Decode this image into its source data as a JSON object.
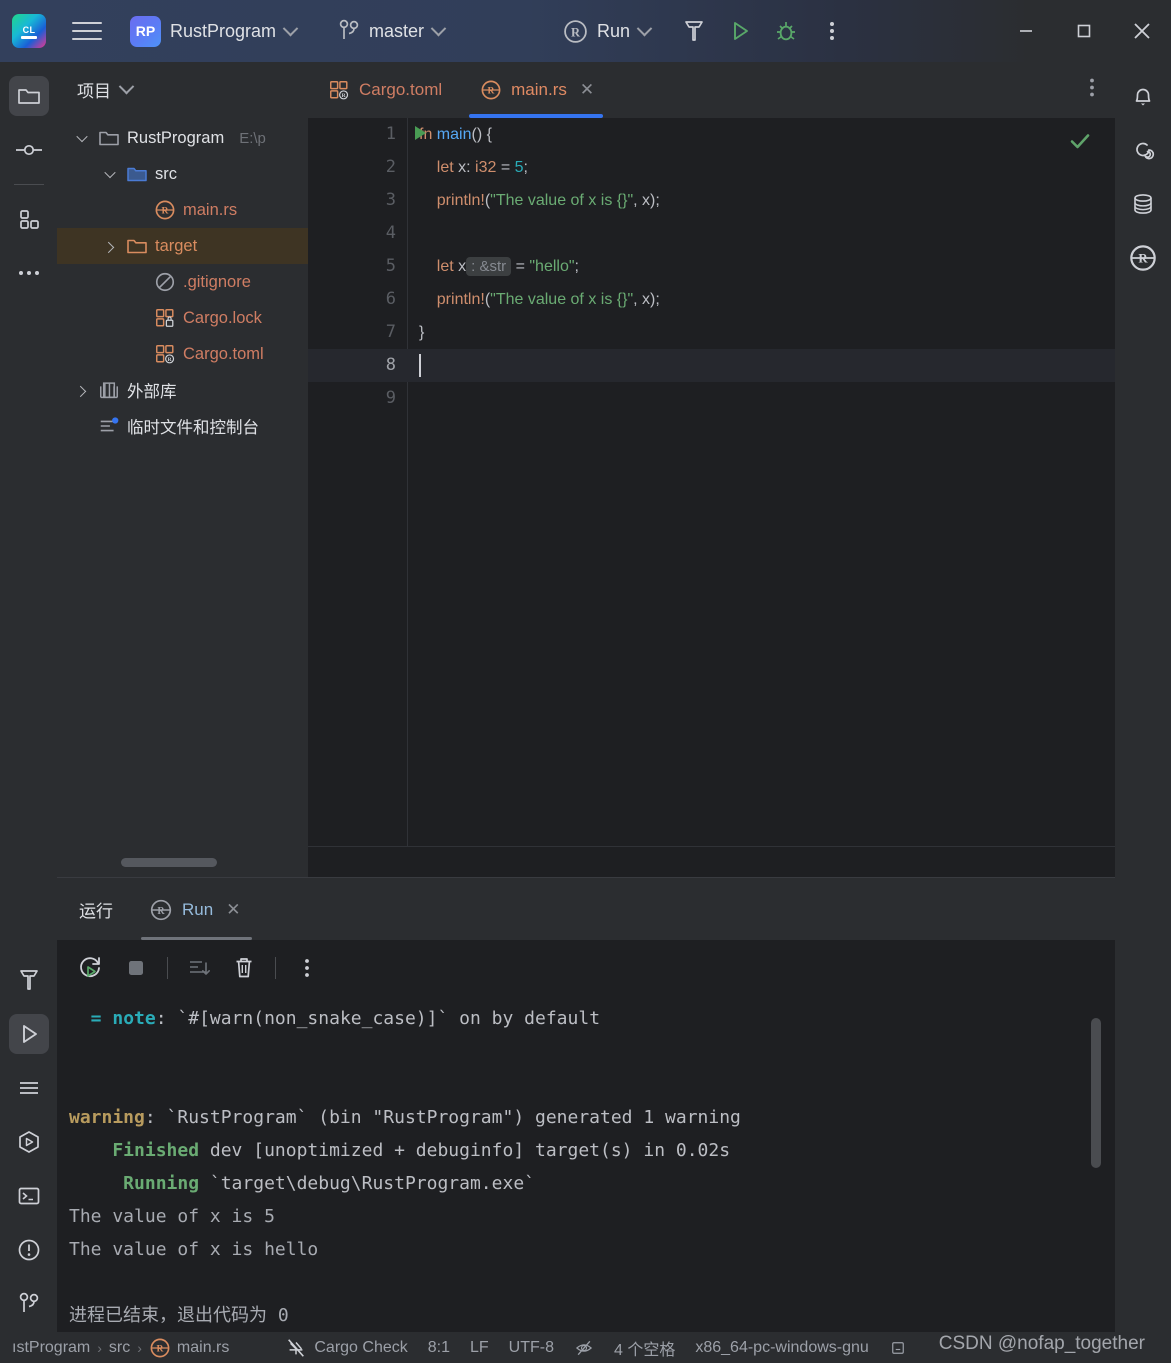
{
  "titlebar": {
    "ide_icon": "clion-logo-icon",
    "menu_icon": "hamburger-menu-icon",
    "project_badge": "RP",
    "project_name": "RustProgram",
    "branch_icon": "git-branch-icon",
    "branch_name": "master",
    "run_config_icon": "rust-logo-icon",
    "run_config_name": "Run",
    "build_icon": "hammer-build-icon",
    "run_icon": "run-triangle-icon",
    "debug_icon": "debug-bug-icon",
    "more_icon": "more-vertical-icon",
    "minimize": "–",
    "maximize": "□",
    "close": "✕"
  },
  "left_rail": {
    "items": [
      {
        "name": "project-tool-window",
        "icon": "folder-icon",
        "active": true
      },
      {
        "name": "commit-tool-window",
        "icon": "commit-node-icon",
        "active": false
      },
      {
        "name": "structure-tool-window",
        "icon": "structure-blocks-icon",
        "active": false
      },
      {
        "name": "more-tool-windows",
        "icon": "ellipsis-icon",
        "active": false
      }
    ],
    "bottom_items": [
      {
        "name": "build-tool-window",
        "icon": "hammer-icon",
        "active": false
      },
      {
        "name": "run-tool-window",
        "icon": "run-triangle-icon",
        "active": true
      },
      {
        "name": "todo-tool-window",
        "icon": "lines-icon",
        "active": false
      },
      {
        "name": "debug-tool-window",
        "icon": "hex-run-icon",
        "active": false
      },
      {
        "name": "terminal-tool-window",
        "icon": "terminal-icon",
        "active": false
      },
      {
        "name": "problems-tool-window",
        "icon": "exclamation-circle-icon",
        "active": false
      },
      {
        "name": "version-control-tool-window",
        "icon": "git-branch-icon",
        "active": false
      }
    ]
  },
  "right_rail": {
    "items": [
      {
        "name": "notifications",
        "icon": "bell-icon"
      },
      {
        "name": "ai-assistant",
        "icon": "spiral-icon"
      },
      {
        "name": "database",
        "icon": "database-icon"
      },
      {
        "name": "rust-tool-window",
        "icon": "rust-logo-icon"
      }
    ]
  },
  "project_panel": {
    "title": "项目",
    "title_chevron": "chevron-down-icon",
    "tree": [
      {
        "indent": 0,
        "arrow": "down",
        "icon": "folder-icon",
        "label": "RustProgram",
        "path": "E:\\p",
        "kind": "root",
        "selected": false
      },
      {
        "indent": 1,
        "arrow": "down",
        "icon": "folder-blue-icon",
        "label": "src",
        "path": "",
        "kind": "src",
        "selected": false
      },
      {
        "indent": 2,
        "arrow": "none",
        "icon": "rust-file-icon",
        "label": "main.rs",
        "path": "",
        "kind": "rs",
        "selected": false
      },
      {
        "indent": 1,
        "arrow": "right",
        "icon": "folder-orange-icon",
        "label": "target",
        "path": "",
        "kind": "target",
        "selected": true
      },
      {
        "indent": 2,
        "arrow": "none",
        "icon": "gitignore-icon",
        "label": ".gitignore",
        "path": "",
        "kind": "file",
        "selected": false
      },
      {
        "indent": 2,
        "arrow": "none",
        "icon": "cargo-lock-icon",
        "label": "Cargo.lock",
        "path": "",
        "kind": "file",
        "selected": false
      },
      {
        "indent": 2,
        "arrow": "none",
        "icon": "cargo-toml-icon",
        "label": "Cargo.toml",
        "path": "",
        "kind": "file",
        "selected": false
      },
      {
        "indent": 0,
        "arrow": "right",
        "icon": "library-icon",
        "label": "外部库",
        "path": "",
        "kind": "lib",
        "selected": false
      },
      {
        "indent": 0,
        "arrow": "none",
        "icon": "scratches-icon",
        "label": "临时文件和控制台",
        "path": "",
        "kind": "scratch",
        "selected": false
      }
    ]
  },
  "editor": {
    "tabs": [
      {
        "label": "Cargo.toml",
        "icon": "cargo-toml-icon",
        "active": false,
        "closable": false
      },
      {
        "label": "main.rs",
        "icon": "rust-file-icon",
        "active": true,
        "closable": true
      }
    ],
    "tab_close_glyph": "✕",
    "more_icon": "more-vertical-icon",
    "inspection_status_icon": "check-ok-icon",
    "current_line": 8,
    "lines": [
      {
        "n": 1,
        "gutter_run_icon": "run-triangle-icon",
        "tokens": [
          {
            "t": "fn ",
            "c": "kw"
          },
          {
            "t": "main",
            "c": "fn"
          },
          {
            "t": "() {",
            "c": "punc"
          }
        ]
      },
      {
        "n": 2,
        "gutter_run_icon": "",
        "tokens": [
          {
            "t": "    ",
            "c": "punc"
          },
          {
            "t": "let ",
            "c": "kw"
          },
          {
            "t": "x: ",
            "c": "ty"
          },
          {
            "t": "i32",
            "c": "kw"
          },
          {
            "t": " = ",
            "c": "punc"
          },
          {
            "t": "5",
            "c": "num"
          },
          {
            "t": ";",
            "c": "punc"
          }
        ]
      },
      {
        "n": 3,
        "gutter_run_icon": "",
        "tokens": [
          {
            "t": "    ",
            "c": "punc"
          },
          {
            "t": "println!",
            "c": "mac"
          },
          {
            "t": "(",
            "c": "punc"
          },
          {
            "t": "\"The value of x is {}\"",
            "c": "str"
          },
          {
            "t": ", x);",
            "c": "punc"
          }
        ]
      },
      {
        "n": 4,
        "gutter_run_icon": "",
        "tokens": []
      },
      {
        "n": 5,
        "gutter_run_icon": "",
        "tokens": [
          {
            "t": "    ",
            "c": "punc"
          },
          {
            "t": "let ",
            "c": "kw"
          },
          {
            "t": "x",
            "c": "ty"
          },
          {
            "t": ": &str",
            "c": "hint"
          },
          {
            "t": " = ",
            "c": "punc"
          },
          {
            "t": "\"hello\"",
            "c": "str"
          },
          {
            "t": ";",
            "c": "punc"
          }
        ]
      },
      {
        "n": 6,
        "gutter_run_icon": "",
        "tokens": [
          {
            "t": "    ",
            "c": "punc"
          },
          {
            "t": "println!",
            "c": "mac"
          },
          {
            "t": "(",
            "c": "punc"
          },
          {
            "t": "\"The value of x is {}\"",
            "c": "str"
          },
          {
            "t": ", x);",
            "c": "punc"
          }
        ]
      },
      {
        "n": 7,
        "gutter_run_icon": "",
        "tokens": [
          {
            "t": "}",
            "c": "punc"
          }
        ]
      },
      {
        "n": 8,
        "gutter_run_icon": "",
        "tokens": [],
        "caret": true
      },
      {
        "n": 9,
        "gutter_run_icon": "",
        "tokens": []
      }
    ]
  },
  "run_panel": {
    "side_label": "运行",
    "tab_label": "Run",
    "tab_icon": "rust-logo-icon",
    "tab_close_glyph": "✕",
    "toolbar": [
      {
        "name": "rerun-button",
        "icon": "rerun-icon",
        "enabled": true
      },
      {
        "name": "stop-button",
        "icon": "stop-square-icon",
        "enabled": false
      },
      {
        "name": "soft-wrap-button",
        "icon": "wrap-down-icon",
        "enabled": false
      },
      {
        "name": "clear-all-button",
        "icon": "trash-icon",
        "enabled": true
      },
      {
        "name": "more-options-button",
        "icon": "more-vertical-icon",
        "enabled": true
      }
    ],
    "console": [
      {
        "segments": [
          {
            "t": "  = ",
            "c": "c-note"
          },
          {
            "t": "note",
            "c": "c-note"
          },
          {
            "t": ": `#[warn(non_snake_case)]` on by default",
            "c": ""
          }
        ]
      },
      {
        "segments": []
      },
      {
        "segments": []
      },
      {
        "segments": [
          {
            "t": "warning",
            "c": "c-warn"
          },
          {
            "t": ": `RustProgram` (bin \"RustProgram\") generated 1 warning",
            "c": ""
          }
        ]
      },
      {
        "segments": [
          {
            "t": "    Finished",
            "c": "c-green"
          },
          {
            "t": " dev [unoptimized + debuginfo] target(s) in 0.02s",
            "c": ""
          }
        ]
      },
      {
        "segments": [
          {
            "t": "     Running",
            "c": "c-green"
          },
          {
            "t": " `target\\debug\\RustProgram.exe`",
            "c": ""
          }
        ]
      },
      {
        "segments": [
          {
            "t": "The value of x is 5",
            "c": "c-dim"
          }
        ]
      },
      {
        "segments": [
          {
            "t": "The value of x is hello",
            "c": "c-dim"
          }
        ]
      },
      {
        "segments": []
      },
      {
        "segments": [
          {
            "t": "进程已结束，退出代码为 0",
            "c": "c-dim"
          }
        ]
      }
    ]
  },
  "status_bar": {
    "breadcrumbs": [
      {
        "label": "ıstProgram",
        "icon": ""
      },
      {
        "label": "src",
        "icon": ""
      },
      {
        "label": "main.rs",
        "icon": "rust-file-icon"
      }
    ],
    "separator": "›",
    "items": [
      {
        "name": "cargo-check-status",
        "icon": "cargo-check-off-icon",
        "label": "Cargo Check"
      },
      {
        "name": "caret-position",
        "icon": "",
        "label": "8:1"
      },
      {
        "name": "line-separator",
        "icon": "",
        "label": "LF"
      },
      {
        "name": "file-encoding",
        "icon": "",
        "label": "UTF-8"
      },
      {
        "name": "reader-mode",
        "icon": "eye-off-icon",
        "label": ""
      },
      {
        "name": "indent-setting",
        "icon": "",
        "label": "4 个空格"
      },
      {
        "name": "toolchain-target",
        "icon": "",
        "label": "x86_64-pc-windows-gnu"
      },
      {
        "name": "memory-indicator",
        "icon": "memory-icon",
        "label": ""
      }
    ]
  },
  "watermark": {
    "text": "CSDN @nofap_together"
  },
  "colors": {
    "titlebar_accent": "#33405c",
    "tab_underline": "#3574f0",
    "selection": "#3e3423",
    "panel_bg": "#2b2d30",
    "editor_bg": "#1e1f22",
    "keyword": "#cf8e6d",
    "string": "#6aab73",
    "number": "#2aacb8",
    "function": "#56a8f5",
    "warning": "#b89b5e",
    "success": "#499c54"
  }
}
